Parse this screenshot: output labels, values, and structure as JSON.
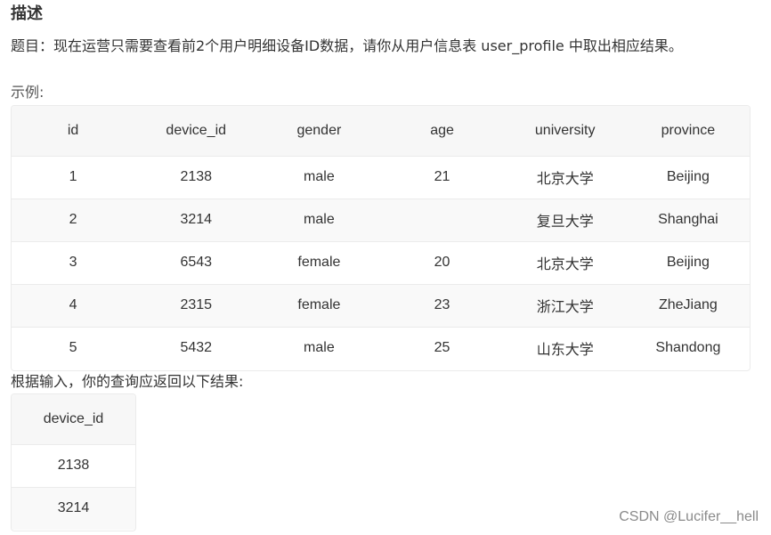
{
  "heading": "描述",
  "question": "题目：现在运营只需要查看前2个用户明细设备ID数据，请你从用户信息表 user_profile 中取出相应结果。",
  "example_label": "示例:",
  "main_table": {
    "headers": [
      "id",
      "device_id",
      "gender",
      "age",
      "university",
      "province"
    ],
    "rows": [
      [
        "1",
        "2138",
        "male",
        "21",
        "北京大学",
        "Beijing"
      ],
      [
        "2",
        "3214",
        "male",
        "",
        "复旦大学",
        "Shanghai"
      ],
      [
        "3",
        "6543",
        "female",
        "20",
        "北京大学",
        "Beijing"
      ],
      [
        "4",
        "2315",
        "female",
        "23",
        "浙江大学",
        "ZheJiang"
      ],
      [
        "5",
        "5432",
        "male",
        "25",
        "山东大学",
        "Shandong"
      ]
    ]
  },
  "result_label": "根据输入，你的查询应返回以下结果:",
  "result_table": {
    "headers": [
      "device_id"
    ],
    "rows": [
      [
        "2138"
      ],
      [
        "3214"
      ]
    ]
  },
  "watermark": "CSDN @Lucifer__hell"
}
